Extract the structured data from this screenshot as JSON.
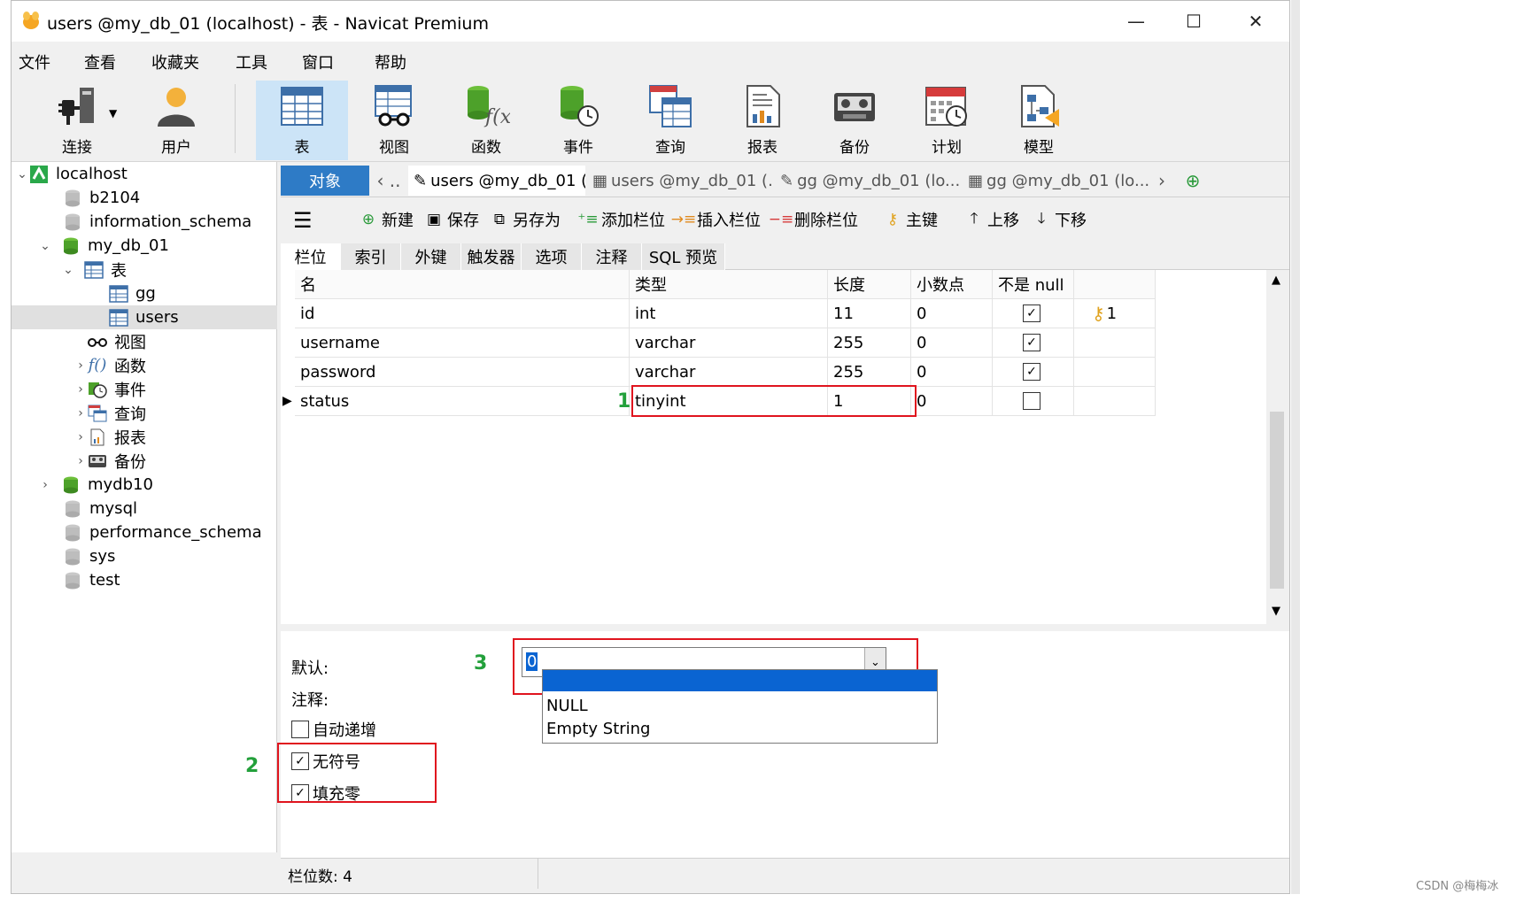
{
  "window": {
    "title": "users @my_db_01 (localhost) - 表 - Navicat Premium",
    "controls": [
      "—",
      "☐",
      "✕"
    ]
  },
  "menu": [
    "文件",
    "查看",
    "收藏夹",
    "工具",
    "窗口",
    "帮助"
  ],
  "toolbar": [
    {
      "label": "连接",
      "icon": "plug-icon"
    },
    {
      "label": "用户",
      "icon": "user-icon"
    },
    {
      "label": "表",
      "icon": "table-icon",
      "active": true
    },
    {
      "label": "视图",
      "icon": "view-icon"
    },
    {
      "label": "函数",
      "icon": "function-icon"
    },
    {
      "label": "事件",
      "icon": "event-icon"
    },
    {
      "label": "查询",
      "icon": "query-icon"
    },
    {
      "label": "报表",
      "icon": "report-icon"
    },
    {
      "label": "备份",
      "icon": "backup-icon"
    },
    {
      "label": "计划",
      "icon": "schedule-icon"
    },
    {
      "label": "模型",
      "icon": "model-icon"
    }
  ],
  "tree": {
    "connection": "localhost",
    "items": [
      "b2104",
      "information_schema",
      "my_db_01",
      "表",
      "gg",
      "users",
      "视图",
      "函数",
      "事件",
      "查询",
      "报表",
      "备份",
      "mydb10",
      "mysql",
      "performance_schema",
      "sys",
      "test"
    ]
  },
  "tabs": {
    "object": "对象",
    "open": [
      "users @my_db_01 (...",
      "users @my_db_01 (...",
      "gg @my_db_01 (lo...",
      "gg @my_db_01 (lo..."
    ]
  },
  "edit_toolbar": [
    "新建",
    "保存",
    "另存为",
    "添加栏位",
    "插入栏位",
    "删除栏位",
    "主键",
    "上移",
    "下移"
  ],
  "subtabs": [
    "栏位",
    "索引",
    "外键",
    "触发器",
    "选项",
    "注释",
    "SQL 预览"
  ],
  "grid": {
    "headers": [
      "名",
      "类型",
      "长度",
      "小数点",
      "不是 null",
      ""
    ],
    "rows": [
      {
        "name": "id",
        "type": "int",
        "length": "11",
        "decimals": "0",
        "not_null": true,
        "key": "1"
      },
      {
        "name": "username",
        "type": "varchar",
        "length": "255",
        "decimals": "0",
        "not_null": true,
        "key": ""
      },
      {
        "name": "password",
        "type": "varchar",
        "length": "255",
        "decimals": "0",
        "not_null": true,
        "key": ""
      },
      {
        "name": "status",
        "type": "tinyint",
        "length": "1",
        "decimals": "0",
        "not_null": false,
        "key": ""
      }
    ]
  },
  "props": {
    "default_label": "默认:",
    "default_value": "0",
    "comment_label": "注释:",
    "auto_increment": {
      "label": "自动递增",
      "checked": false
    },
    "unsigned": {
      "label": "无符号",
      "checked": true
    },
    "zerofill": {
      "label": "填充零",
      "checked": true
    },
    "dropdown_options": [
      "",
      "NULL",
      "Empty String"
    ]
  },
  "annotations": [
    "1",
    "2",
    "3"
  ],
  "status": "栏位数: 4",
  "watermark": "CSDN @梅梅冰",
  "colors": {
    "accent": "#2e7bc6",
    "annotation_box": "#e0141e",
    "annotation_text": "#23a03b",
    "selection": "#0a64d2"
  }
}
